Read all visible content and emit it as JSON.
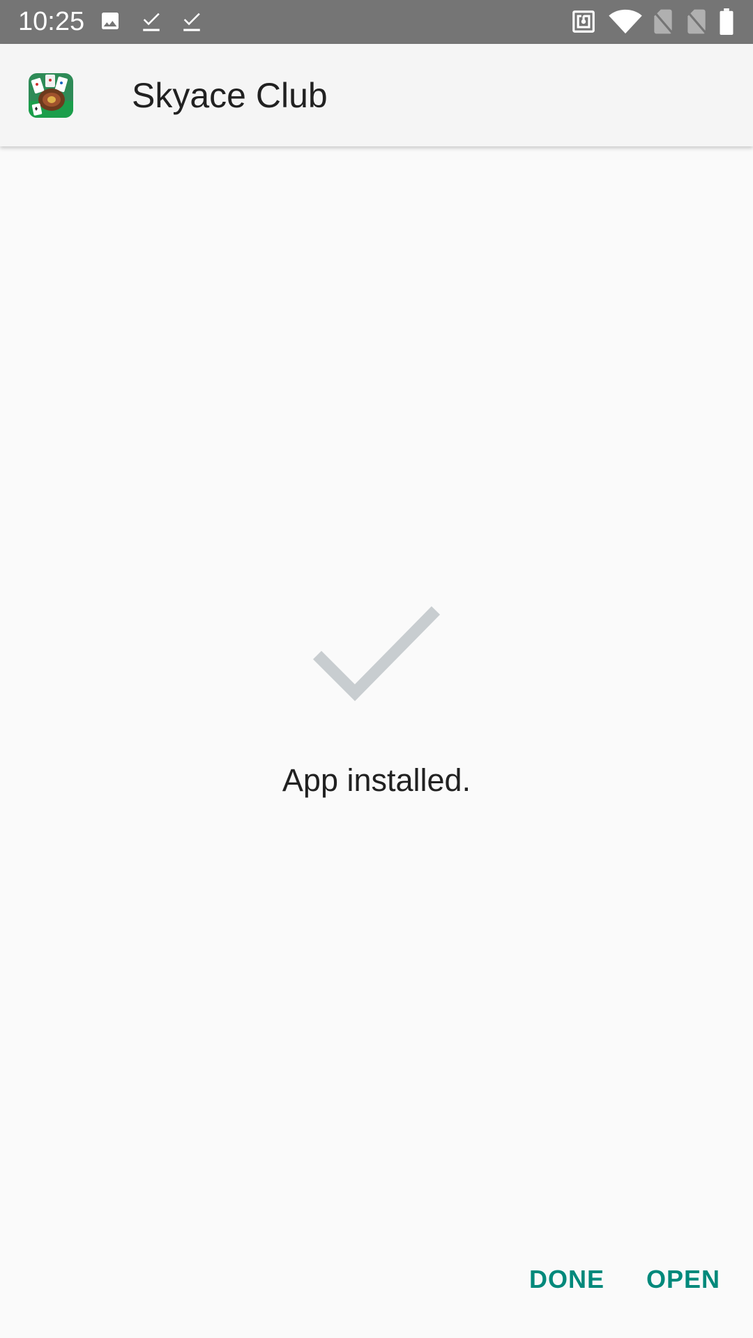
{
  "status_bar": {
    "time": "10:25",
    "left_icons": [
      "image-icon",
      "check-icon",
      "check-icon"
    ],
    "right_icons": [
      "nfc-icon",
      "wifi-icon",
      "no-sim-icon",
      "no-sim-icon",
      "battery-icon"
    ],
    "background": "#757575"
  },
  "app_bar": {
    "app_icon": "skyace-club-app-icon",
    "title": "Skyace Club"
  },
  "main": {
    "status_icon": "checkmark-icon",
    "message": "App installed."
  },
  "actions": {
    "done_label": "DONE",
    "open_label": "OPEN",
    "accent_color": "#00897b"
  }
}
